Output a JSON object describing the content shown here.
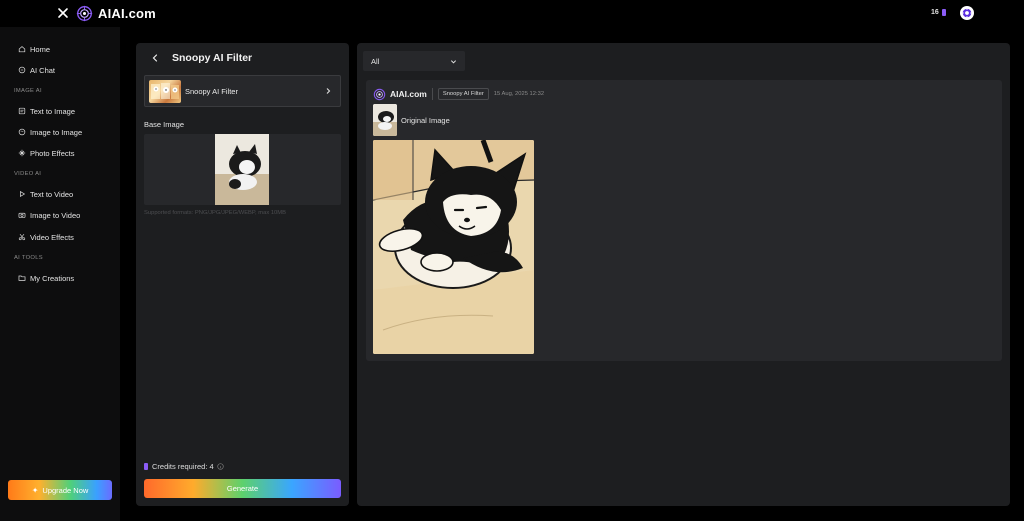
{
  "topbar": {
    "brand": "AIAI.com",
    "credits": "16"
  },
  "sidebar": {
    "items": [
      {
        "label": "Home",
        "icon": "home-icon"
      },
      {
        "label": "AI Chat",
        "icon": "chat-icon"
      }
    ],
    "sections": [
      {
        "title": "IMAGE AI",
        "items": [
          {
            "label": "Text to Image",
            "icon": "image-icon"
          },
          {
            "label": "Image to Image",
            "icon": "palette-icon"
          },
          {
            "label": "Photo Effects",
            "icon": "sparkle-icon"
          }
        ]
      },
      {
        "title": "VIDEO AI",
        "items": [
          {
            "label": "Text to Video",
            "icon": "play-icon"
          },
          {
            "label": "Image to Video",
            "icon": "camera-icon"
          },
          {
            "label": "Video Effects",
            "icon": "scissors-icon"
          }
        ]
      },
      {
        "title": "AI TOOLS",
        "items": [
          {
            "label": "My Creations",
            "icon": "folder-icon"
          }
        ]
      }
    ],
    "upgrade_label": "Upgrade Now"
  },
  "editor": {
    "title": "Snoopy AI Filter",
    "filter_name": "Snoopy AI Filter",
    "base_image_label": "Base Image",
    "supported_text": "Supported formats: PNG/JPG/JPEG/WEBP, max 10MB",
    "credits_required": "Credits required: 4",
    "generate_label": "Generate"
  },
  "results": {
    "filter_value": "All",
    "card": {
      "brand": "AIAI.com",
      "tag": "Snoopy AI Filter",
      "date": "15 Aug, 2025 12:32",
      "original_label": "Original Image"
    }
  },
  "colors": {
    "accent": "#8b5cf6",
    "panel": "#1d1e20",
    "card": "#27282b"
  }
}
